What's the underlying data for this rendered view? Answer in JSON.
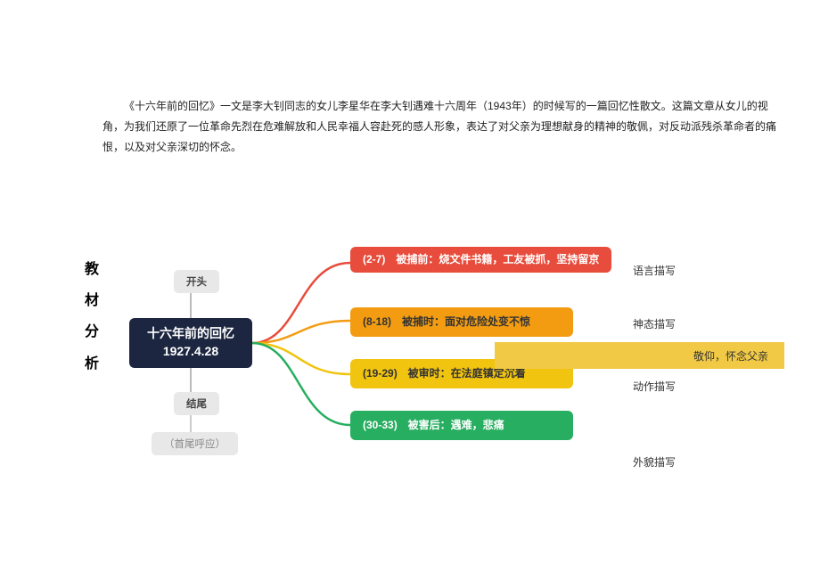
{
  "paragraph": {
    "text": "《十六年前的回忆》一文是李大钊同志的女儿李星华在李大钊遇难十六周年（1943年）的时候写的一篇回忆性散文。这篇文章从女儿的视角，为我们还原了一位革命先烈在危难解放和人民幸福人容赴死的感人形象，表达了对父亲为理想献身的精神的敬佩，对反动派残杀革命者的痛恨，以及对父亲深切的怀念。"
  },
  "vlabel": {
    "c1": "教",
    "c2": "材",
    "c3": "分",
    "c4": "析"
  },
  "center": {
    "line1": "十六年前的回忆",
    "line2": "1927.4.28"
  },
  "tags": {
    "top": "开头",
    "bot": "结尾",
    "sub": "（首尾呼应）"
  },
  "branches": {
    "b1": "(2-7)　被捕前：烧文件书籍，工友被抓，坚持留京",
    "b2": "(8-18)　被捕时：面对危险处变不惊",
    "b3": "(19-29)　被审时：在法庭镇定沉着",
    "b4": "(30-33)　被害后：遇难，悲痛"
  },
  "descs": {
    "d1": "语言描写",
    "d2": "神态描写",
    "d3": "动作描写",
    "d4": "外貌描写"
  },
  "bigbar": "敬仰，怀念父亲",
  "chart_data": {
    "type": "mindmap",
    "root": {
      "title": "十六年前的回忆",
      "subtitle": "1927.4.28"
    },
    "structure_tags": [
      "开头",
      "结尾",
      "（首尾呼应）"
    ],
    "branches": [
      {
        "range": "2-7",
        "stage": "被捕前",
        "detail": "烧文件书籍，工友被抓，坚持留京",
        "technique": "语言描写",
        "color": "#e74c3c"
      },
      {
        "range": "8-18",
        "stage": "被捕时",
        "detail": "面对危险处变不惊",
        "technique": "神态描写",
        "color": "#f39c12"
      },
      {
        "range": "19-29",
        "stage": "被审时",
        "detail": "在法庭镇定沉着",
        "technique": "动作描写",
        "color": "#f1c40f"
      },
      {
        "range": "30-33",
        "stage": "被害后",
        "detail": "遇难，悲痛",
        "technique": "外貌描写",
        "color": "#27ae60"
      }
    ],
    "conclusion": "敬仰，怀念父亲"
  }
}
